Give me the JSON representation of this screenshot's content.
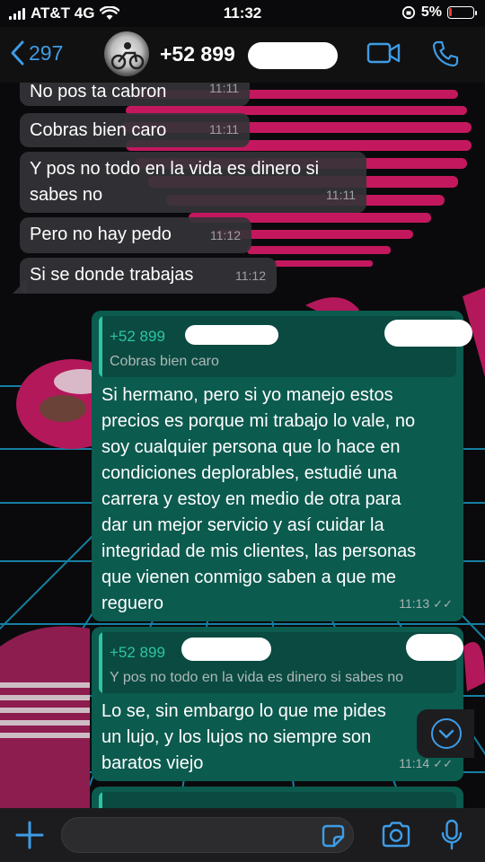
{
  "status_bar": {
    "carrier": "AT&T 4G",
    "time": "11:32",
    "battery": "5%"
  },
  "header": {
    "back_count": "297",
    "contact_name": "+52 899"
  },
  "messages": [
    {
      "text": "No pos ta cabron",
      "time": "11:11"
    },
    {
      "text": "Cobras bien caro",
      "time": "11:11"
    },
    {
      "text_lines": [
        "Y pos no todo en la vida es dinero si",
        "sabes no"
      ],
      "time": "11:11"
    },
    {
      "text": "Pero no hay pedo",
      "time": "11:12"
    },
    {
      "text": "Si se donde trabajas",
      "time": "11:12"
    },
    {
      "quote_name": "+52 899",
      "quote_text": "Cobras bien caro",
      "text_lines": [
        "Si hermano, pero si yo manejo estos",
        "precios es porque mi trabajo lo vale, no",
        "soy cualquier persona que lo hace en",
        "condiciones deplorables, estudié una",
        "carrera y estoy en medio de otra para",
        "dar un mejor servicio y así cuidar la",
        "integridad de mis clientes, las personas",
        "que vienen conmigo saben a que me",
        "reguero"
      ],
      "time": "11:13"
    },
    {
      "quote_name": "+52 899",
      "quote_text": "Y pos no todo en la vida es dinero si sabes no",
      "text_lines": [
        "Lo se, sin embargo lo que me pides",
        "un lujo, y los lujos no siempre son",
        "baratos viejo"
      ],
      "time": "11:14"
    }
  ],
  "input": {
    "value": ""
  },
  "colors": {
    "accent": "#3e9ce6",
    "outgoing_bubble": "#0c5b4f",
    "incoming_bubble": "#343438",
    "quote_accent": "#2ec4a4"
  }
}
